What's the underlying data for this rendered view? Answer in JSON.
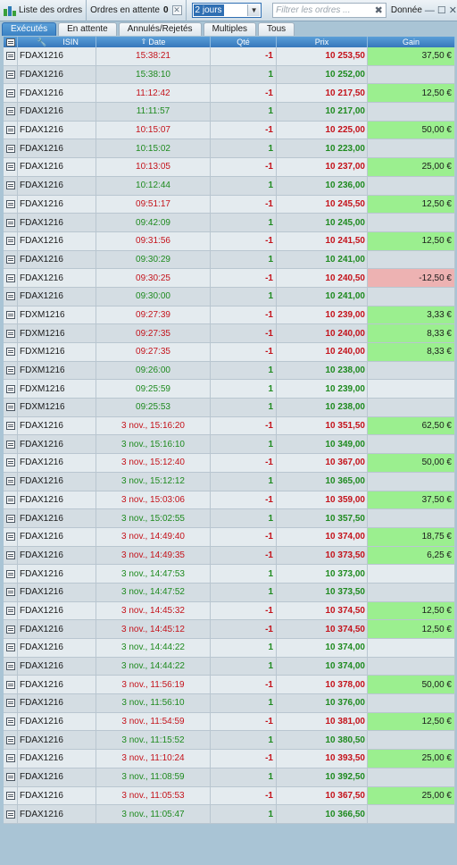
{
  "titlebar": {
    "list_label": "Liste des ordres",
    "pending_label": "Ordres en attente",
    "pending_count": "0",
    "period_value": "2 jours",
    "filter_placeholder": "Filtrer les ordres ...",
    "data_label": "Donnée"
  },
  "tabs": [
    "Exécutés",
    "En attente",
    "Annulés/Rejetés",
    "Multiples",
    "Tous"
  ],
  "columns": {
    "isin": "ISIN",
    "date": "Date",
    "qty": "Qté",
    "price": "Prix",
    "gain": "Gain"
  },
  "colors": {
    "header": "#3b82c4",
    "loss_text": "#c4121a",
    "gain_text": "#1e8a1e",
    "gain_bg": "#9bef8f",
    "loss_bg": "#edb2b2"
  },
  "orders": [
    {
      "isin": "FDAX1216",
      "date": "15:38:21",
      "qty": "-1",
      "price": "10 253,50",
      "gain": "37,50 €"
    },
    {
      "isin": "FDAX1216",
      "date": "15:38:10",
      "qty": "1",
      "price": "10 252,00",
      "gain": ""
    },
    {
      "isin": "FDAX1216",
      "date": "11:12:42",
      "qty": "-1",
      "price": "10 217,50",
      "gain": "12,50 €"
    },
    {
      "isin": "FDAX1216",
      "date": "11:11:57",
      "qty": "1",
      "price": "10 217,00",
      "gain": ""
    },
    {
      "isin": "FDAX1216",
      "date": "10:15:07",
      "qty": "-1",
      "price": "10 225,00",
      "gain": "50,00 €"
    },
    {
      "isin": "FDAX1216",
      "date": "10:15:02",
      "qty": "1",
      "price": "10 223,00",
      "gain": ""
    },
    {
      "isin": "FDAX1216",
      "date": "10:13:05",
      "qty": "-1",
      "price": "10 237,00",
      "gain": "25,00 €"
    },
    {
      "isin": "FDAX1216",
      "date": "10:12:44",
      "qty": "1",
      "price": "10 236,00",
      "gain": ""
    },
    {
      "isin": "FDAX1216",
      "date": "09:51:17",
      "qty": "-1",
      "price": "10 245,50",
      "gain": "12,50 €"
    },
    {
      "isin": "FDAX1216",
      "date": "09:42:09",
      "qty": "1",
      "price": "10 245,00",
      "gain": ""
    },
    {
      "isin": "FDAX1216",
      "date": "09:31:56",
      "qty": "-1",
      "price": "10 241,50",
      "gain": "12,50 €"
    },
    {
      "isin": "FDAX1216",
      "date": "09:30:29",
      "qty": "1",
      "price": "10 241,00",
      "gain": ""
    },
    {
      "isin": "FDAX1216",
      "date": "09:30:25",
      "qty": "-1",
      "price": "10 240,50",
      "gain": "-12,50 €"
    },
    {
      "isin": "FDAX1216",
      "date": "09:30:00",
      "qty": "1",
      "price": "10 241,00",
      "gain": ""
    },
    {
      "isin": "FDXM1216",
      "date": "09:27:39",
      "qty": "-1",
      "price": "10 239,00",
      "gain": "3,33 €"
    },
    {
      "isin": "FDXM1216",
      "date": "09:27:35",
      "qty": "-1",
      "price": "10 240,00",
      "gain": "8,33 €"
    },
    {
      "isin": "FDXM1216",
      "date": "09:27:35",
      "qty": "-1",
      "price": "10 240,00",
      "gain": "8,33 €"
    },
    {
      "isin": "FDXM1216",
      "date": "09:26:00",
      "qty": "1",
      "price": "10 238,00",
      "gain": ""
    },
    {
      "isin": "FDXM1216",
      "date": "09:25:59",
      "qty": "1",
      "price": "10 239,00",
      "gain": ""
    },
    {
      "isin": "FDXM1216",
      "date": "09:25:53",
      "qty": "1",
      "price": "10 238,00",
      "gain": ""
    },
    {
      "isin": "FDAX1216",
      "date": "3 nov., 15:16:20",
      "qty": "-1",
      "price": "10 351,50",
      "gain": "62,50 €"
    },
    {
      "isin": "FDAX1216",
      "date": "3 nov., 15:16:10",
      "qty": "1",
      "price": "10 349,00",
      "gain": ""
    },
    {
      "isin": "FDAX1216",
      "date": "3 nov., 15:12:40",
      "qty": "-1",
      "price": "10 367,00",
      "gain": "50,00 €"
    },
    {
      "isin": "FDAX1216",
      "date": "3 nov., 15:12:12",
      "qty": "1",
      "price": "10 365,00",
      "gain": ""
    },
    {
      "isin": "FDAX1216",
      "date": "3 nov., 15:03:06",
      "qty": "-1",
      "price": "10 359,00",
      "gain": "37,50 €"
    },
    {
      "isin": "FDAX1216",
      "date": "3 nov., 15:02:55",
      "qty": "1",
      "price": "10 357,50",
      "gain": ""
    },
    {
      "isin": "FDAX1216",
      "date": "3 nov., 14:49:40",
      "qty": "-1",
      "price": "10 374,00",
      "gain": "18,75 €"
    },
    {
      "isin": "FDAX1216",
      "date": "3 nov., 14:49:35",
      "qty": "-1",
      "price": "10 373,50",
      "gain": "6,25 €"
    },
    {
      "isin": "FDAX1216",
      "date": "3 nov., 14:47:53",
      "qty": "1",
      "price": "10 373,00",
      "gain": ""
    },
    {
      "isin": "FDAX1216",
      "date": "3 nov., 14:47:52",
      "qty": "1",
      "price": "10 373,50",
      "gain": ""
    },
    {
      "isin": "FDAX1216",
      "date": "3 nov., 14:45:32",
      "qty": "-1",
      "price": "10 374,50",
      "gain": "12,50 €"
    },
    {
      "isin": "FDAX1216",
      "date": "3 nov., 14:45:12",
      "qty": "-1",
      "price": "10 374,50",
      "gain": "12,50 €"
    },
    {
      "isin": "FDAX1216",
      "date": "3 nov., 14:44:22",
      "qty": "1",
      "price": "10 374,00",
      "gain": ""
    },
    {
      "isin": "FDAX1216",
      "date": "3 nov., 14:44:22",
      "qty": "1",
      "price": "10 374,00",
      "gain": ""
    },
    {
      "isin": "FDAX1216",
      "date": "3 nov., 11:56:19",
      "qty": "-1",
      "price": "10 378,00",
      "gain": "50,00 €"
    },
    {
      "isin": "FDAX1216",
      "date": "3 nov., 11:56:10",
      "qty": "1",
      "price": "10 376,00",
      "gain": ""
    },
    {
      "isin": "FDAX1216",
      "date": "3 nov., 11:54:59",
      "qty": "-1",
      "price": "10 381,00",
      "gain": "12,50 €"
    },
    {
      "isin": "FDAX1216",
      "date": "3 nov., 11:15:52",
      "qty": "1",
      "price": "10 380,50",
      "gain": ""
    },
    {
      "isin": "FDAX1216",
      "date": "3 nov., 11:10:24",
      "qty": "-1",
      "price": "10 393,50",
      "gain": "25,00 €"
    },
    {
      "isin": "FDAX1216",
      "date": "3 nov., 11:08:59",
      "qty": "1",
      "price": "10 392,50",
      "gain": ""
    },
    {
      "isin": "FDAX1216",
      "date": "3 nov., 11:05:53",
      "qty": "-1",
      "price": "10 367,50",
      "gain": "25,00 €"
    },
    {
      "isin": "FDAX1216",
      "date": "3 nov., 11:05:47",
      "qty": "1",
      "price": "10 366,50",
      "gain": ""
    }
  ]
}
